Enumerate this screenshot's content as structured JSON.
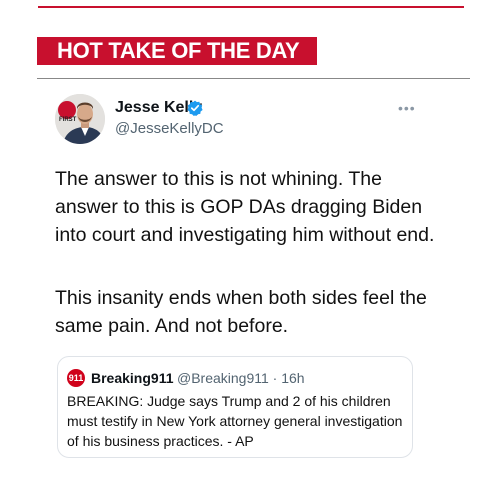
{
  "banner": {
    "title": "HOT TAKE OF THE DAY"
  },
  "tweet": {
    "author_name": "Jesse Kelly",
    "author_handle": "@JesseKellyDC",
    "avatar_logo_text": "FIRST",
    "verified": true,
    "more_icon": "more-horizontal-icon",
    "paragraphs": [
      "The answer to this is not whining. The answer to this is GOP DAs dragging Biden into court and investigating him without end.",
      "This insanity ends when both sides feel the same pain. And not before."
    ]
  },
  "quoted_tweet": {
    "avatar_text": "911",
    "author_name": "Breaking911",
    "meta": "@Breaking911 · 16h",
    "text": "BREAKING: Judge says Trump and 2 of his children must testify in New York attorney general investigation of his business practices. - AP"
  },
  "colors": {
    "brand_red": "#c8102e",
    "verified_blue": "#1d9bf0",
    "muted_text": "#536471"
  }
}
